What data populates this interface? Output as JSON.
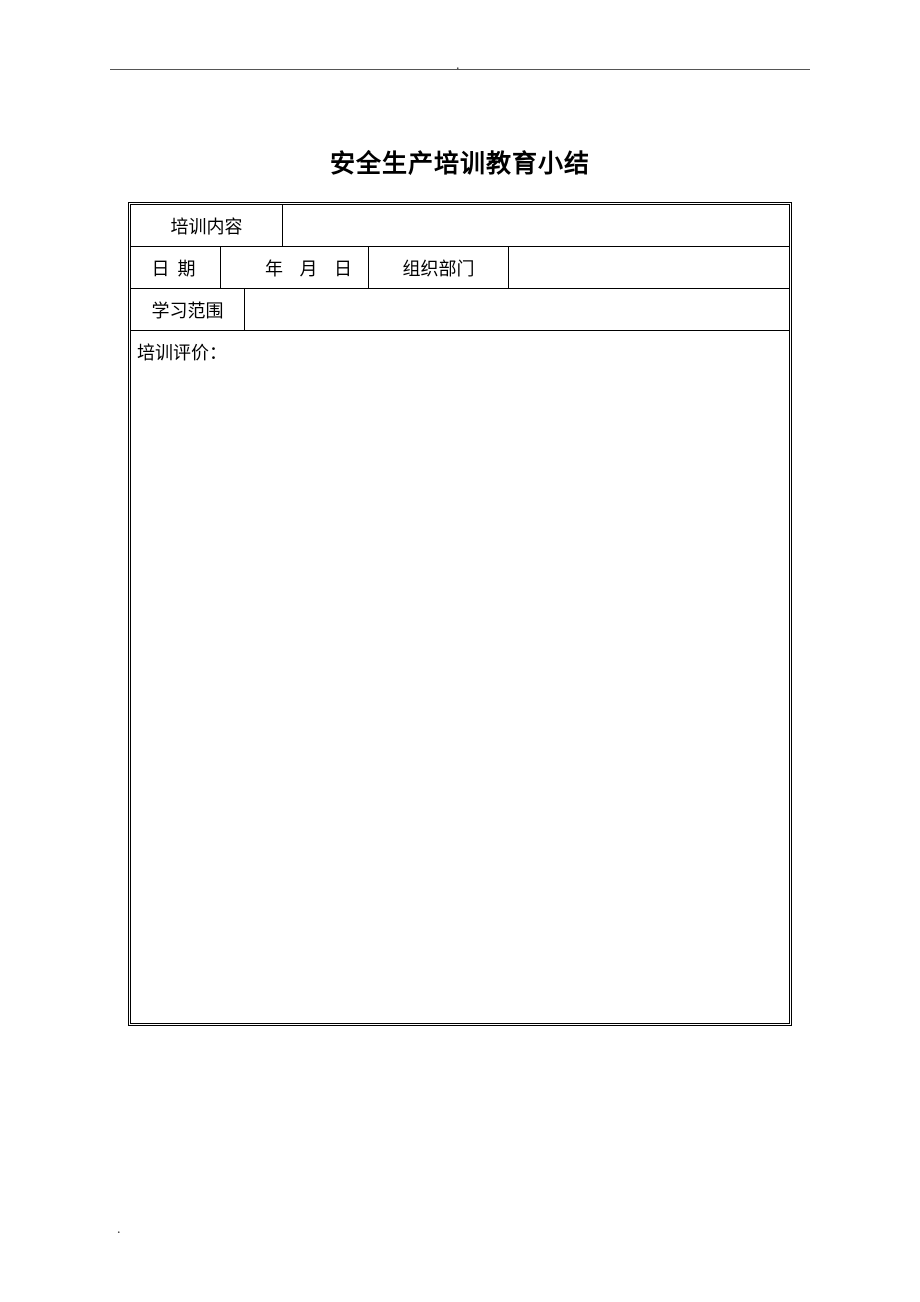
{
  "title": "安全生产培训教育小结",
  "labels": {
    "training_content": "培训内容",
    "date": "日期",
    "date_value": "年 月 日",
    "org_dept": "组织部门",
    "study_scope": "学习范围",
    "training_eval": "培训评价："
  },
  "dots": {
    "top": ".",
    "bottom": "."
  }
}
